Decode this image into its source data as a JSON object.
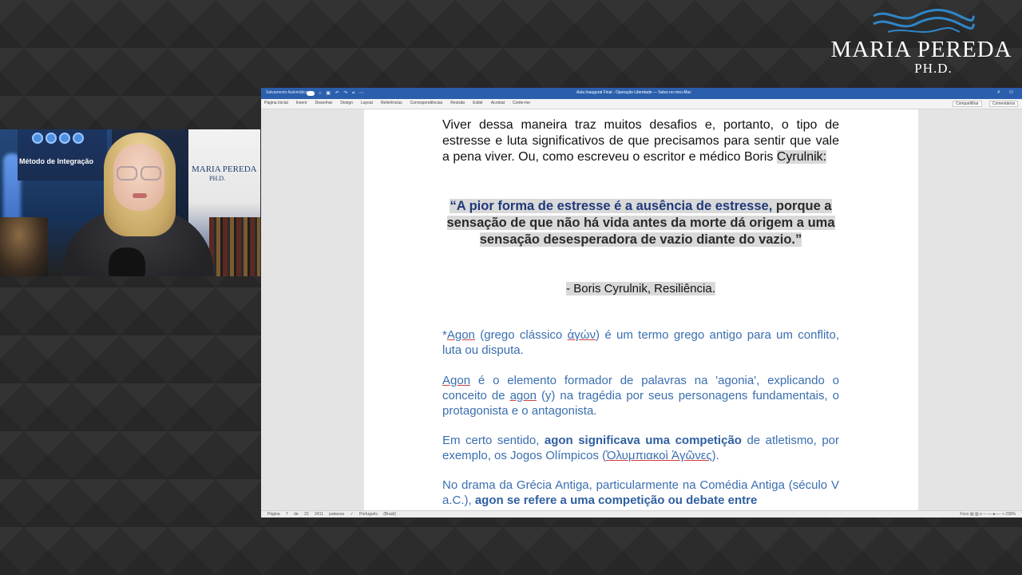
{
  "brand": {
    "name": "MARIA PEREDA",
    "subtitle": "PH.D."
  },
  "webcam": {
    "banner_text": "Método de Integração",
    "poster_name": "MARIA PEREDA",
    "poster_sub": "PH.D."
  },
  "word": {
    "autosave_label": "Salvamento Automático",
    "quick_icons": "⌂ ▣ ↶ ↷ ⌗ ⋯",
    "doc_title": "Aula Inaugural Final - Operação Liberdade — Salvo no meu Mac",
    "window_icons": "⌕ ☺",
    "ribbon_tabs": [
      "Página Inicial",
      "Inserir",
      "Desenhar",
      "Design",
      "Layout",
      "Referências",
      "Correspondências",
      "Revisão",
      "Exibir",
      "Acrobat",
      "Conte-me"
    ],
    "share_label": "Compartilhar",
    "comments_label": "Comentários",
    "status_left": "Página 7 de 22  2411 palavras  ✓  Português (Brasil)",
    "status_right": "Foco  ▤ ▥ ≡   ─ ──●── +  230%"
  },
  "document": {
    "intro_a": "Viver dessa maneira traz muitos desafios e, portanto, o tipo de estresse e luta significativos de que precisamos para sentir que vale a pena viver. Ou, como escreveu o escritor e médico Boris ",
    "intro_b": "Cyrulnik:",
    "quote_a": "“A pior forma de estresse é a ausência de estresse,",
    "quote_b": " porque a sensação de que não há vida antes da morte dá origem a uma sensação desesperadora de vazio diante do vazio.”",
    "attribution": "- Boris Cyrulnik, Resiliência.",
    "p1_a": "*",
    "p1_b": "Agon",
    "p1_c": " (grego clássico ",
    "p1_d": "ἀγών",
    "p1_e": ") é um termo grego antigo para um conflito, luta ou disputa.",
    "p2_a": " ",
    "p2_b": "Agon",
    "p2_c": " é o elemento formador de palavras na 'agonia', explicando o conceito de ",
    "p2_d": "agon",
    "p2_e": " (y) na tragédia por seus personagens fundamentais, o protagonista e o antagonista.",
    "p3_a": "Em certo sentido, ",
    "p3_b": "agon significava uma competição",
    "p3_c": " de atletismo, por exemplo, os Jogos Olímpicos (",
    "p3_d": "Ὀλυμπιακοὶ Ἀγῶνες",
    "p3_e": ").",
    "p4_a": "No drama da Grécia Antiga, particularmente na Comédia Antiga (século V a.C.), ",
    "p4_b": "agon se refere a uma competição ou debate entre"
  }
}
